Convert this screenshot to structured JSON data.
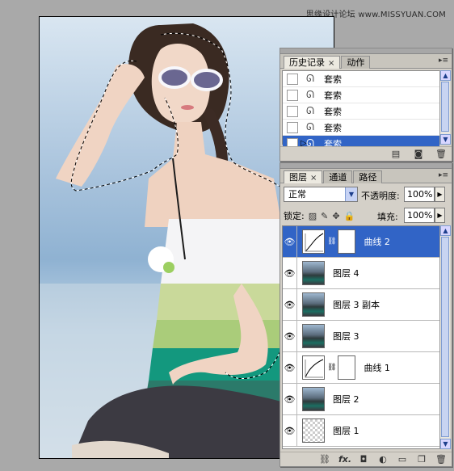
{
  "watermark": "思缘设计论坛  www.MISSYUAN.COM",
  "history_panel": {
    "tabs": [
      {
        "label": "历史记录",
        "close": "×",
        "active": true
      },
      {
        "label": "动作",
        "close": "",
        "active": false
      }
    ],
    "menu_icon": "▸≡",
    "states": [
      {
        "label": "套索",
        "selected": false
      },
      {
        "label": "套索",
        "selected": false
      },
      {
        "label": "套索",
        "selected": false
      },
      {
        "label": "套索",
        "selected": false
      },
      {
        "label": "套索",
        "selected": true
      }
    ],
    "current_state_marker": "▷",
    "footer_icons": [
      "new-document-from-state-icon",
      "snapshot-camera-icon",
      "trash-icon"
    ]
  },
  "layers_panel": {
    "tabs": [
      {
        "label": "图层",
        "close": "×",
        "active": true
      },
      {
        "label": "通道",
        "close": "",
        "active": false
      },
      {
        "label": "路径",
        "close": "",
        "active": false
      }
    ],
    "menu_icon": "▸≡",
    "blend_mode": "正常",
    "opacity_label": "不透明度:",
    "opacity": "100%",
    "lock_label": "锁定:",
    "fill_label": "填充:",
    "fill": "100%",
    "layers": [
      {
        "name": "曲线 2",
        "kind": "curves",
        "selected": true,
        "visible": true
      },
      {
        "name": "图层 4",
        "kind": "photo",
        "selected": false,
        "visible": true
      },
      {
        "name": "图层 3 副本",
        "kind": "photo",
        "selected": false,
        "visible": true
      },
      {
        "name": "图层 3",
        "kind": "photo",
        "selected": false,
        "visible": true
      },
      {
        "name": "曲线 1",
        "kind": "curves",
        "selected": false,
        "visible": true
      },
      {
        "name": "图层 2",
        "kind": "photo",
        "selected": false,
        "visible": true
      },
      {
        "name": "图层 1",
        "kind": "transparent",
        "selected": false,
        "visible": true
      }
    ],
    "footer_icons": [
      "link-layers-icon",
      "fx-icon",
      "add-mask-icon",
      "adjustment-layer-icon",
      "new-group-icon",
      "new-layer-icon",
      "trash-icon"
    ],
    "footer_fx_label": "fx."
  },
  "colors": {
    "selection_blue": "#3164c6",
    "panel_gray": "#d4d0c8",
    "workspace_gray": "#a9a9a9"
  }
}
